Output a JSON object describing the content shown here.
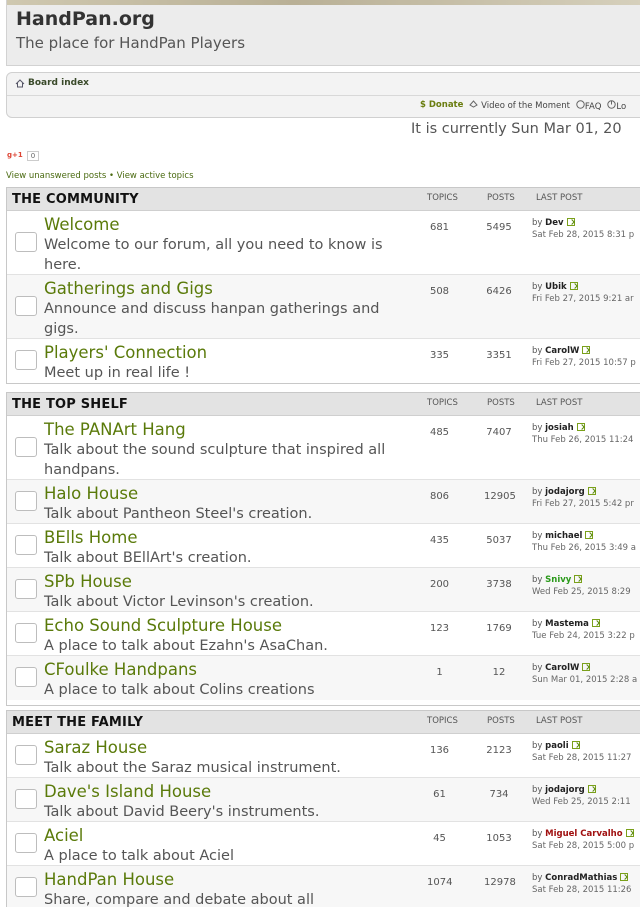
{
  "header": {
    "site_title": "HandPan.org",
    "site_desc": "The place for HandPan Players"
  },
  "nav": {
    "board_index": "Board index",
    "donate": "$ Donate",
    "video": "Video of the Moment",
    "faq": "FAQ",
    "login": "Lo"
  },
  "current_time": "It is currently Sun Mar 01, 20",
  "gplus": {
    "label": "g+1",
    "count": "0"
  },
  "quick_links": {
    "unanswered": "View unanswered posts",
    "separator": " • ",
    "active": "View active topics"
  },
  "columns": {
    "topics": "TOPICS",
    "posts": "POSTS",
    "last_post": "LAST POST"
  },
  "sections": [
    {
      "title": "THE COMMUNITY",
      "forums": [
        {
          "name": "Welcome",
          "desc": "Welcome to our forum, all you need to know is here.",
          "topics": "681",
          "posts": "5495",
          "by": "by",
          "author": "Dev",
          "date": "Sat Feb 28, 2015 8:31 p"
        },
        {
          "name": "Gatherings and Gigs",
          "desc": "Announce and discuss hanpan gatherings and gigs.",
          "topics": "508",
          "posts": "6426",
          "by": "by",
          "author": "Ubik",
          "date": "Fri Feb 27, 2015 9:21 ar"
        },
        {
          "name": "Players' Connection",
          "desc": "Meet up in real life !",
          "topics": "335",
          "posts": "3351",
          "by": "by",
          "author": "CarolW",
          "date": "Fri Feb 27, 2015 10:57 p"
        }
      ]
    },
    {
      "title": "THE TOP SHELF",
      "forums": [
        {
          "name": "The PANArt Hang",
          "desc": "Talk about the sound sculpture that inspired all handpans.",
          "topics": "485",
          "posts": "7407",
          "by": "by",
          "author": "josiah",
          "date": "Thu Feb 26, 2015 11:24"
        },
        {
          "name": "Halo House",
          "desc": "Talk about Pantheon Steel's creation.",
          "topics": "806",
          "posts": "12905",
          "by": "by",
          "author": "jodajorg",
          "date": "Fri Feb 27, 2015 5:42 pr"
        },
        {
          "name": "BElls Home",
          "desc": "Talk about BEllArt's creation.",
          "topics": "435",
          "posts": "5037",
          "by": "by",
          "author": "michael",
          "date": "Thu Feb 26, 2015 3:49 a"
        },
        {
          "name": "SPb House",
          "desc": "Talk about Victor Levinson's creation.",
          "topics": "200",
          "posts": "3738",
          "by": "by",
          "author": "Snivy",
          "date": "Wed Feb 25, 2015 8:29"
        },
        {
          "name": "Echo Sound Sculpture House",
          "desc": "A place to talk about Ezahn's AsaChan.",
          "topics": "123",
          "posts": "1769",
          "by": "by",
          "author": "Mastema",
          "date": "Tue Feb 24, 2015 3:22 p"
        },
        {
          "name": "CFoulke Handpans",
          "desc": "A place to talk about Colins creations",
          "topics": "1",
          "posts": "12",
          "by": "by",
          "author": "CarolW",
          "date": "Sun Mar 01, 2015 2:28 a"
        }
      ]
    },
    {
      "title": "MEET THE FAMILY",
      "forums": [
        {
          "name": "Saraz House",
          "desc": "Talk about the Saraz musical instrument.",
          "topics": "136",
          "posts": "2123",
          "by": "by",
          "author": "paoli",
          "date": "Sat Feb 28, 2015 11:27"
        },
        {
          "name": "Dave's Island House",
          "desc": "Talk about David Beery's instruments.",
          "topics": "61",
          "posts": "734",
          "by": "by",
          "author": "jodajorg",
          "date": "Wed Feb 25, 2015 2:11"
        },
        {
          "name": "Aciel",
          "desc": "A place to talk about Aciel",
          "topics": "45",
          "posts": "1053",
          "by": "by",
          "author": "Miguel Carvalho",
          "date": "Sat Feb 28, 2015 5:00 p"
        },
        {
          "name": "HandPan House",
          "desc": "Share, compare and debate about all",
          "topics": "1074",
          "posts": "12978",
          "by": "by",
          "author": "ConradMathias",
          "date": "Sat Feb 28, 2015 11:26"
        }
      ]
    }
  ],
  "colors": {
    "accent": "#5a7a0a",
    "header_bg": "#ececec",
    "section_head": "#e3e3e3",
    "author_green": "#2a9a1a",
    "author_red": "#a01010"
  },
  "icons": {
    "home": "home-icon",
    "goto": "goto-post-icon",
    "video": "video-icon",
    "faq": "faq-icon",
    "login": "login-icon"
  }
}
